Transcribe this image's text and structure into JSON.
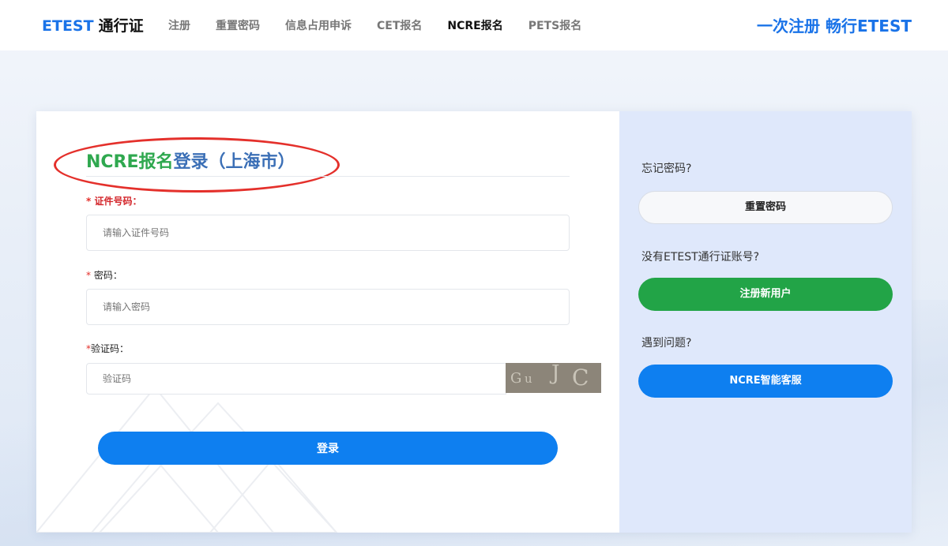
{
  "header": {
    "brand": "ETEST",
    "brand_cn": "通行证",
    "nav": [
      {
        "label": "注册"
      },
      {
        "label": "重置密码"
      },
      {
        "label": "信息占用申诉"
      },
      {
        "label": "CET报名"
      },
      {
        "label": "NCRE报名",
        "active": true
      },
      {
        "label": "PETS报名"
      }
    ],
    "slogan": "一次注册 畅行ETEST"
  },
  "login": {
    "title_part1": "NCRE报名",
    "title_part2": "登录（上海市）",
    "id_label": "证件号码：",
    "id_placeholder": "请输入证件号码",
    "password_label": "密码：",
    "password_placeholder": "请输入密码",
    "captcha_label": "验证码：",
    "captcha_placeholder": "验证码",
    "captcha_text": "GuJC",
    "required_mark": "*",
    "submit_label": "登录"
  },
  "side": {
    "forgot_text": "忘记密码?",
    "reset_label": "重置密码",
    "no_account_text": "没有ETEST通行证账号?",
    "register_label": "注册新用户",
    "help_text": "遇到问题?",
    "service_label": "NCRE智能客服"
  },
  "colors": {
    "primary": "#0e7ff0",
    "green": "#22a447",
    "highlight": "#e4302b",
    "side_panel": "#dfe8fb"
  }
}
